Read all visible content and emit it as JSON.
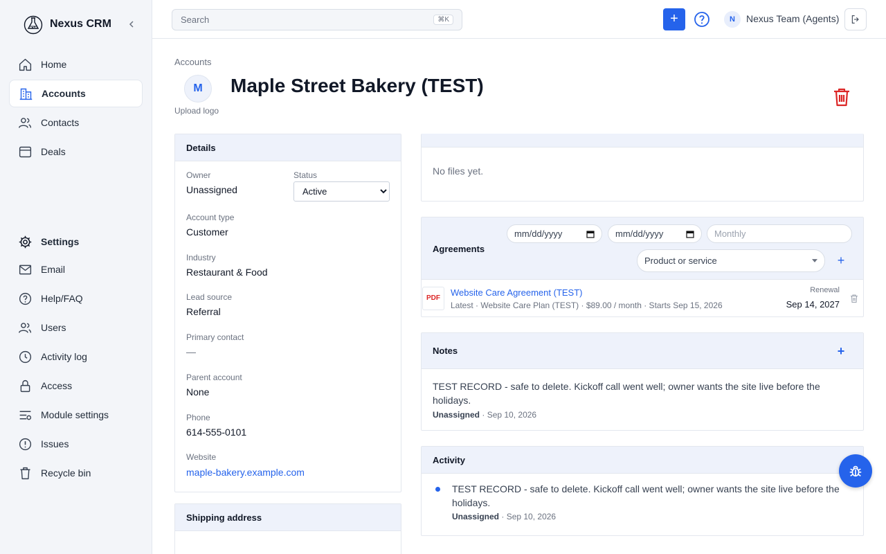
{
  "app": {
    "name": "Nexus CRM"
  },
  "sidebar": {
    "collapse_icon": "chevron-left-icon",
    "primary": [
      {
        "label": "Home",
        "icon": "home-icon"
      },
      {
        "label": "Accounts",
        "icon": "building-icon",
        "active": true
      },
      {
        "label": "Contacts",
        "icon": "users-icon"
      },
      {
        "label": "Deals",
        "icon": "wallet-icon"
      }
    ],
    "secondary": [
      {
        "label": "Settings",
        "icon": "gear-icon"
      },
      {
        "label": "Email",
        "icon": "mail-icon"
      },
      {
        "label": "Help/FAQ",
        "icon": "help-circle-icon"
      },
      {
        "label": "Users",
        "icon": "users-icon"
      },
      {
        "label": "Activity log",
        "icon": "clock-icon"
      },
      {
        "label": "Access",
        "icon": "lock-icon"
      },
      {
        "label": "Module settings",
        "icon": "sliders-icon"
      },
      {
        "label": "Issues",
        "icon": "alert-circle-icon"
      },
      {
        "label": "Recycle bin",
        "icon": "trash-icon"
      }
    ]
  },
  "topbar": {
    "search_placeholder": "Search",
    "search_shortcut": "⌘K",
    "add_label": "+",
    "user_initial": "N",
    "user_name": "Nexus Team (Agents)"
  },
  "page": {
    "breadcrumb": "Accounts",
    "logo_initial": "M",
    "upload_logo": "Upload logo",
    "title": "Maple Street Bakery (TEST)"
  },
  "details": {
    "title": "Details",
    "owner_label": "Owner",
    "owner_value": "Unassigned",
    "status_label": "Status",
    "status_value": "Active",
    "account_type_label": "Account type",
    "account_type_value": "Customer",
    "industry_label": "Industry",
    "industry_value": "Restaurant & Food",
    "lead_source_label": "Lead source",
    "lead_source_value": "Referral",
    "primary_contact_label": "Primary contact",
    "primary_contact_value": "—",
    "parent_account_label": "Parent account",
    "parent_account_value": "None",
    "phone_label": "Phone",
    "phone_value": "614-555-0101",
    "website_label": "Website",
    "website_value": "maple-bakery.example.com"
  },
  "shipping": {
    "title": "Shipping address"
  },
  "files": {
    "empty_text": "No files yet."
  },
  "agreements": {
    "title": "Agreements",
    "start_date_placeholder": "mm/dd/yyyy",
    "end_date_placeholder": "mm/dd/yyyy",
    "frequency_placeholder": "Monthly",
    "product_placeholder": "Product or service",
    "add_label": "+",
    "items": [
      {
        "file_type": "PDF",
        "name": "Website Care Agreement (TEST)",
        "meta": "Latest · Website Care Plan (TEST) · $89.00 / month · Starts Sep 15, 2026",
        "renewal_label": "Renewal",
        "renewal_date": "Sep 14, 2027"
      }
    ]
  },
  "notes": {
    "title": "Notes",
    "add_label": "+",
    "items": [
      {
        "text": "TEST RECORD - safe to delete. Kickoff call went well; owner wants the site live before the holidays.",
        "author": "Unassigned",
        "date": "· Sep 10, 2026"
      }
    ]
  },
  "activity": {
    "title": "Activity",
    "items": [
      {
        "text": "TEST RECORD - safe to delete. Kickoff call went well; owner wants the site live before the holidays.",
        "author": "Unassigned",
        "date": "· Sep 10, 2026"
      }
    ]
  },
  "colors": {
    "accent": "#2563eb",
    "danger": "#dc2626",
    "panel_header": "#eef2fb"
  }
}
